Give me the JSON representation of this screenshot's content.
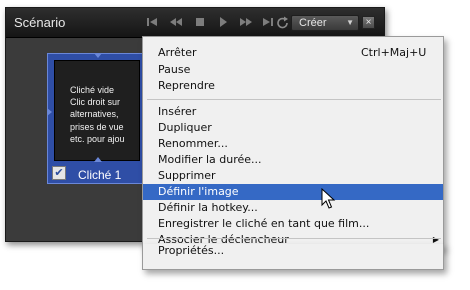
{
  "panel": {
    "title": "Scénario",
    "transport_icons": [
      "skip-back-icon",
      "rewind-icon",
      "stop-icon",
      "play-icon",
      "fast-forward-icon",
      "skip-forward-icon",
      "loop-icon"
    ],
    "create_label": "Créer",
    "close_label": "×"
  },
  "snapshot": {
    "text": "Cliché vide\nClic droit sur\nalternatives,\nprises de vue\netc. pour ajou",
    "label": "Cliché 1",
    "checked_glyph": "✔"
  },
  "menu": {
    "items": [
      {
        "label": "Arrêter",
        "shortcut": "Ctrl+Maj+U"
      },
      {
        "label": "Pause"
      },
      {
        "label": "Reprendre"
      },
      {
        "label": "Insérer"
      },
      {
        "label": "Dupliquer"
      },
      {
        "label": "Renommer..."
      },
      {
        "label": "Modifier la durée..."
      },
      {
        "label": "Supprimer"
      },
      {
        "label": "Définir l'image",
        "highlighted": true
      },
      {
        "label": "Définir la hotkey..."
      },
      {
        "label": "Enregistrer le cliché en tant que film..."
      },
      {
        "label": "Associer le déclencheur",
        "submenu": "▶"
      },
      {
        "label": "Propriétés..."
      }
    ]
  },
  "colors": {
    "highlight": "#3569c5",
    "card_blue": "#2f4ea6",
    "panel_dark": "#3a3a3a"
  }
}
